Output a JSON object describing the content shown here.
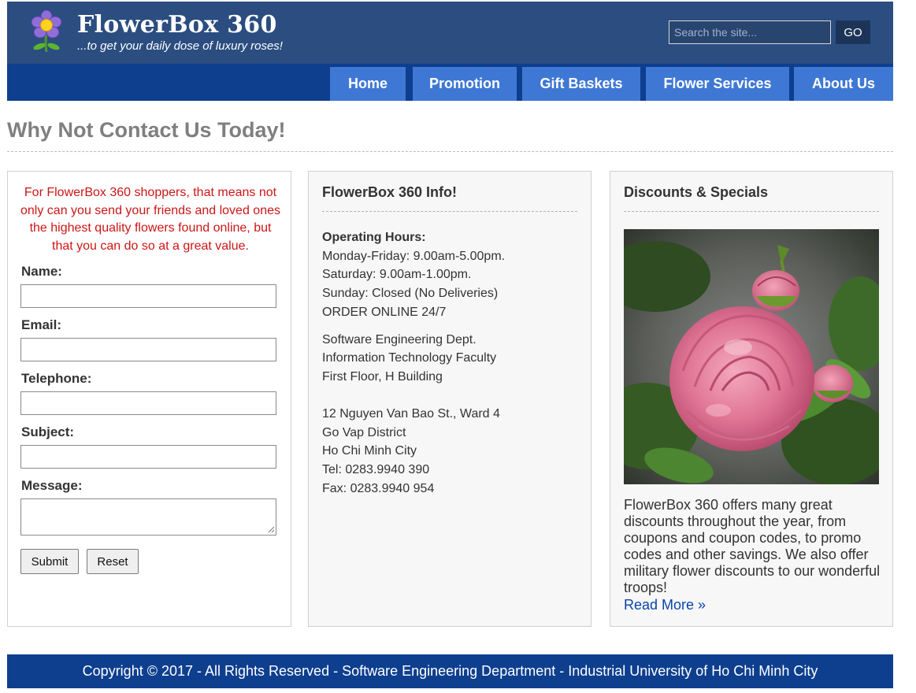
{
  "header": {
    "brand": "FlowerBox 360",
    "tagline": "...to get your daily dose of luxury roses!",
    "search_placeholder": "Search the site...",
    "search_button": "GO"
  },
  "nav": {
    "items": [
      {
        "label": "Home"
      },
      {
        "label": "Promotion"
      },
      {
        "label": "Gift Baskets"
      },
      {
        "label": "Flower Services"
      },
      {
        "label": "About Us"
      }
    ]
  },
  "page_title": "Why Not Contact Us Today!",
  "contact": {
    "intro": "For FlowerBox 360 shoppers, that means not only can you send your friends and loved ones the highest quality flowers found online, but that you can do so at a great value.",
    "fields": {
      "name": "Name:",
      "email": "Email:",
      "telephone": "Telephone:",
      "subject": "Subject:",
      "message": "Message:"
    },
    "submit": "Submit",
    "reset": "Reset"
  },
  "info": {
    "heading": "FlowerBox 360 Info!",
    "hours_label": "Operating Hours:",
    "hours": [
      "Monday-Friday: 9.00am-5.00pm.",
      "Saturday: 9.00am-1.00pm.",
      "Sunday: Closed (No Deliveries)",
      "ORDER ONLINE 24/7"
    ],
    "department": [
      "Software Engineering Dept.",
      "Information Technology Faculty",
      "First Floor, H Building"
    ],
    "address": [
      "12 Nguyen Van Bao St., Ward 4",
      "Go Vap District",
      "Ho Chi Minh City",
      "Tel: 0283.9940 390",
      "Fax: 0283.9940 954"
    ]
  },
  "specials": {
    "heading": "Discounts & Specials",
    "text": "FlowerBox 360 offers many great discounts throughout the year, from coupons and coupon codes, to promo codes and other savings. We also offer military flower discounts to our wonderful troops!",
    "read_more": "Read More »"
  },
  "footer": {
    "text": "Copyright © 2017 - All Rights Reserved - Software Engineering Department - Industrial University of Ho Chi Minh City"
  },
  "colors": {
    "header_bg": "#2b4d80",
    "nav_bg": "#0e3f8f",
    "nav_item_bg": "#3f78d4",
    "title_gray": "#7f7f7f",
    "intro_red": "#cc1616",
    "link_blue": "#0a44a8"
  },
  "icons": {
    "logo": "flower-logo-icon",
    "textarea_resize": "resize-grip-icon"
  }
}
